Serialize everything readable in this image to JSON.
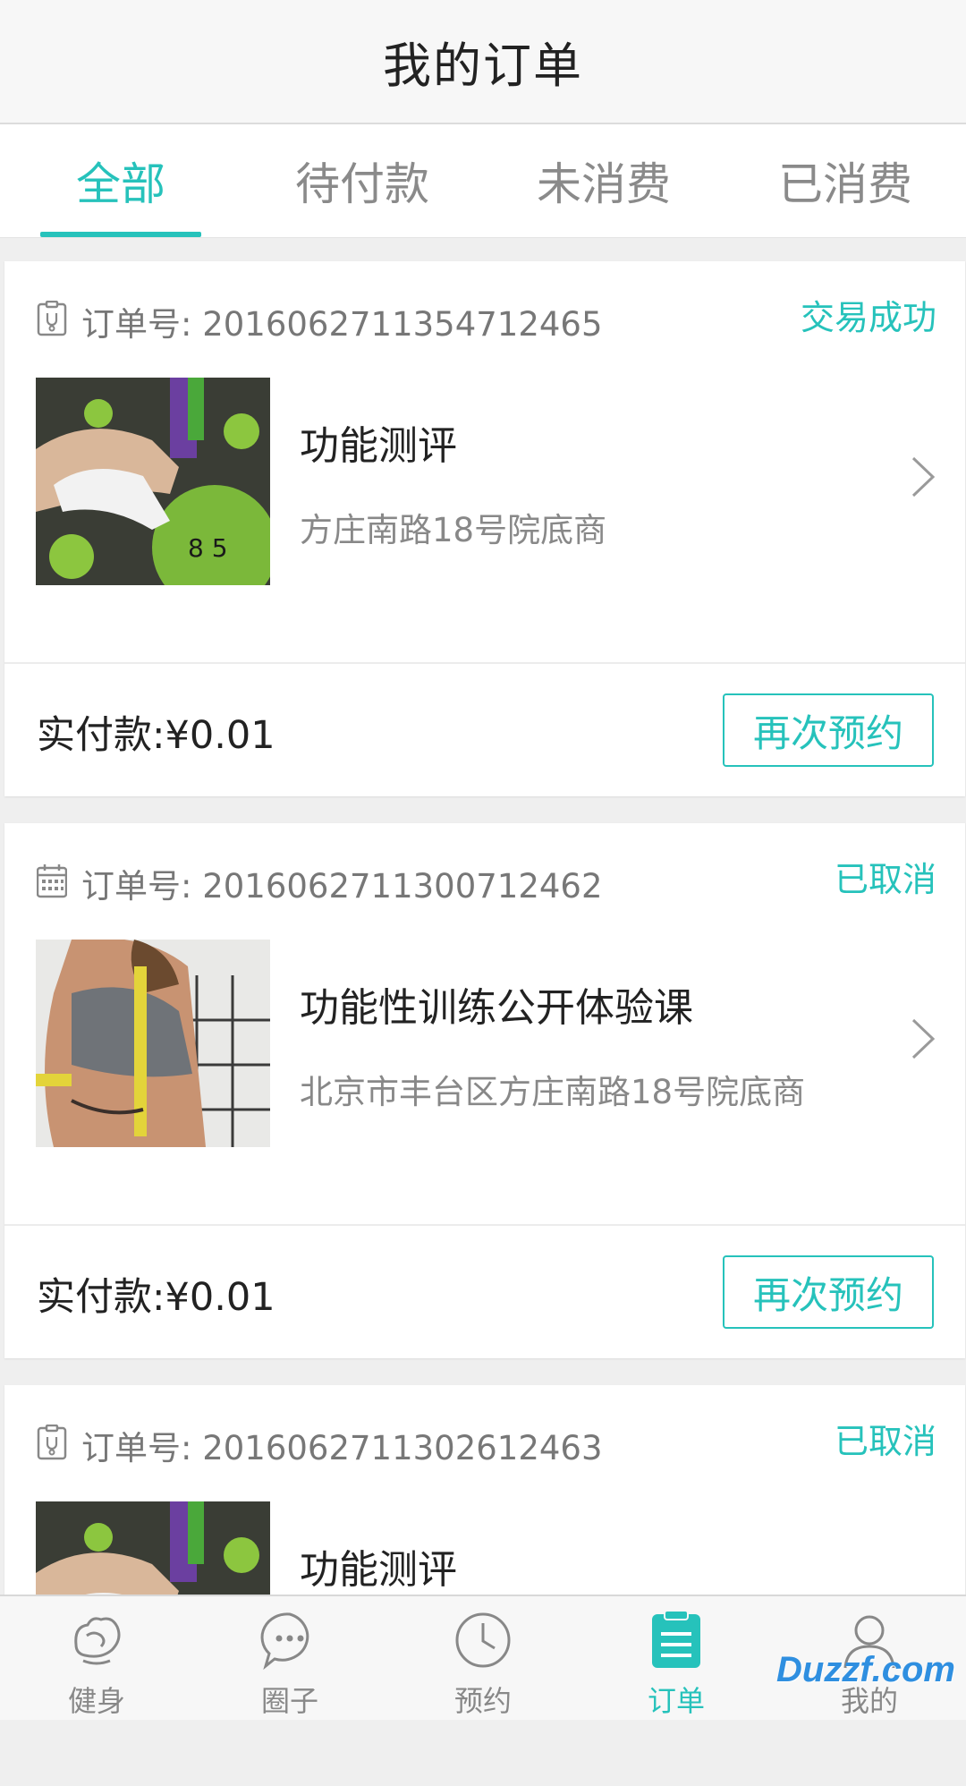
{
  "header": {
    "title": "我的订单"
  },
  "tabs": [
    {
      "label": "全部",
      "active": true
    },
    {
      "label": "待付款",
      "active": false
    },
    {
      "label": "未消费",
      "active": false
    },
    {
      "label": "已消费",
      "active": false
    }
  ],
  "orders": [
    {
      "order_no": "订单号: 2016062711354712465",
      "status": "交易成功",
      "product_name": "功能测评",
      "address": "方庄南路18号院底商",
      "paid": "实付款:¥0.01",
      "action_label": "再次预约",
      "icon": "clipboard-stethoscope-icon"
    },
    {
      "order_no": "订单号: 2016062711300712462",
      "status": "已取消",
      "product_name": "功能性训练公开体验课",
      "address": "北京市丰台区方庄南路18号院底商",
      "paid": "实付款:¥0.01",
      "action_label": "再次预约",
      "icon": "calendar-icon"
    },
    {
      "order_no": "订单号: 2016062711302612463",
      "status": "已取消",
      "product_name": "功能测评",
      "icon": "clipboard-stethoscope-icon"
    }
  ],
  "bottom_nav": [
    {
      "label": "健身",
      "icon": "muscle-icon",
      "active": false
    },
    {
      "label": "圈子",
      "icon": "chat-bubble-icon",
      "active": false
    },
    {
      "label": "预约",
      "icon": "clock-icon",
      "active": false
    },
    {
      "label": "订单",
      "icon": "clipboard-list-icon",
      "active": true
    },
    {
      "label": "我的",
      "icon": "person-icon",
      "active": false
    }
  ],
  "watermark": "Duzzf.com",
  "colors": {
    "accent": "#26c2bb",
    "text": "#222222",
    "muted": "#888888"
  }
}
